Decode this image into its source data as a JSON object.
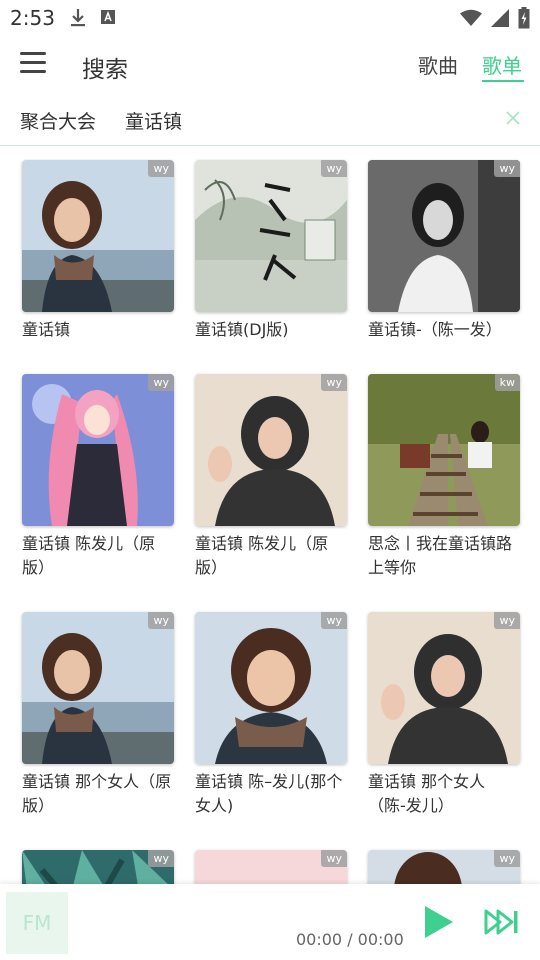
{
  "status": {
    "time": "2:53",
    "icons_left": [
      "download-icon",
      "font-a-icon"
    ],
    "icons_right": [
      "wifi-icon",
      "signal-icon",
      "battery-charging-icon"
    ]
  },
  "header": {
    "title": "搜索",
    "tabs": [
      {
        "label": "歌曲",
        "active": false
      },
      {
        "label": "歌单",
        "active": true
      }
    ],
    "accent_color": "#3fcf8e"
  },
  "search": {
    "source": "聚合大会",
    "query": "童话镇"
  },
  "playlists": [
    {
      "title": "童话镇",
      "source": "wy",
      "cover": "girl-scarf-sea"
    },
    {
      "title": "童话镇(DJ版)",
      "source": "wy",
      "cover": "calligraphy-landscape"
    },
    {
      "title": "童话镇-（陈一发）",
      "source": "wy",
      "cover": "bw-girl-portrait"
    },
    {
      "title": "童话镇 陈发儿（原版）",
      "source": "wy",
      "cover": "anime-pink-hair"
    },
    {
      "title": "童话镇 陈发儿（原版）",
      "source": "wy",
      "cover": "girl-black-hoodie"
    },
    {
      "title": "思念丨我在童话镇路上等你",
      "source": "kw",
      "cover": "railway-girl"
    },
    {
      "title": "童话镇 那个女人（原版）",
      "source": "wy",
      "cover": "girl-scarf-sea"
    },
    {
      "title": "童话镇 陈–发儿(那个女人)",
      "source": "wy",
      "cover": "girl-scarf-closeup"
    },
    {
      "title": "童话镇 那个女人（陈-发儿）",
      "source": "wy",
      "cover": "girl-black-hoodie"
    },
    {
      "title": "",
      "source": "wy",
      "cover": "tropical-leaves"
    },
    {
      "title": "",
      "source": "wy",
      "cover": "pink-sky"
    },
    {
      "title": "",
      "source": "wy",
      "cover": "girl-hair-partial"
    }
  ],
  "player": {
    "thumb_label": "FM",
    "time": "00:00 / 00:00"
  }
}
